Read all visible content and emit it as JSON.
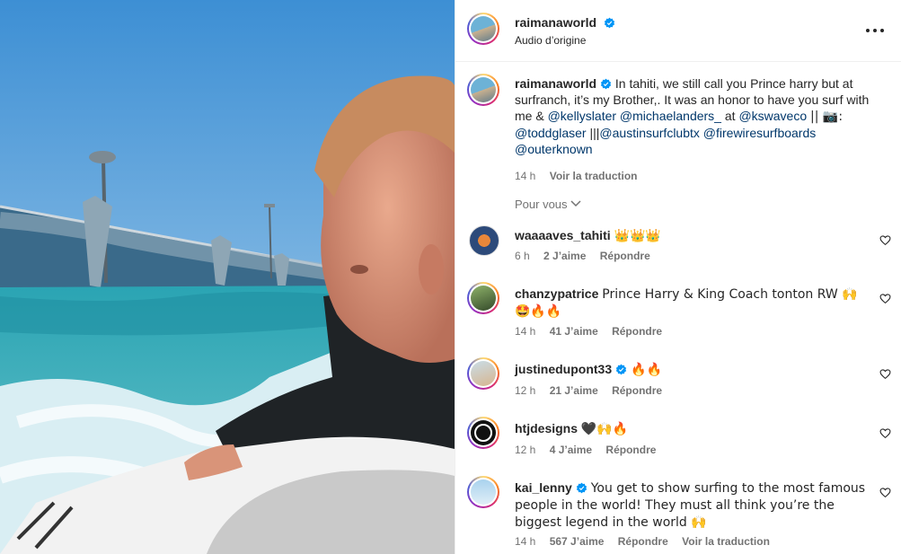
{
  "post": {
    "author": "raimanaworld",
    "audio": "Audio d’origine",
    "more_icon": "more-horizontal-icon"
  },
  "caption": {
    "author": "raimanaworld",
    "text_1": "In tahiti, we still call you Prince harry but at surfranch, it’s my Brother,. It was an honor to have you surf with me &",
    "mention_1": "@kellyslater",
    "mention_2": "@michaelanders_",
    "text_2": "at",
    "mention_3": "@kswaveco",
    "text_3": "|| 📷:",
    "mention_4": "@toddglaser",
    "text_4": "|||",
    "mention_5": "@austinsurfclubtx",
    "mention_6": "@firewiresurfboards",
    "mention_7": "@outerknown",
    "time": "14 h",
    "translate": "Voir la traduction"
  },
  "section_label": "Pour vous",
  "comments": [
    {
      "user": "waaaaves_tahiti",
      "text": "👑👑👑",
      "time": "6 h",
      "likes": "2 J’aime",
      "reply": "Répondre",
      "verified": false
    },
    {
      "user": "chanzypatrice",
      "text": "Prince Harry & King Coach tonton RW 🙌🤩🔥🔥",
      "time": "14 h",
      "likes": "41 J’aime",
      "reply": "Répondre",
      "verified": false
    },
    {
      "user": "justinedupont33",
      "text": "🔥🔥",
      "time": "12 h",
      "likes": "21 J’aime",
      "reply": "Répondre",
      "verified": true
    },
    {
      "user": "htjdesigns",
      "text": "🖤🙌🔥",
      "time": "12 h",
      "likes": "4 J’aime",
      "reply": "Répondre",
      "verified": false
    },
    {
      "user": "kai_lenny",
      "text": "You get to show surfing to the most famous people in the world! They must all think you’re the biggest legend in the world 🙌",
      "time": "14 h",
      "likes": "567 J’aime",
      "reply": "Répondre",
      "translate": "Voir la traduction",
      "verified": true
    }
  ],
  "colors": {
    "link": "#00376b",
    "verified": "#0095f6",
    "muted": "#737373"
  }
}
